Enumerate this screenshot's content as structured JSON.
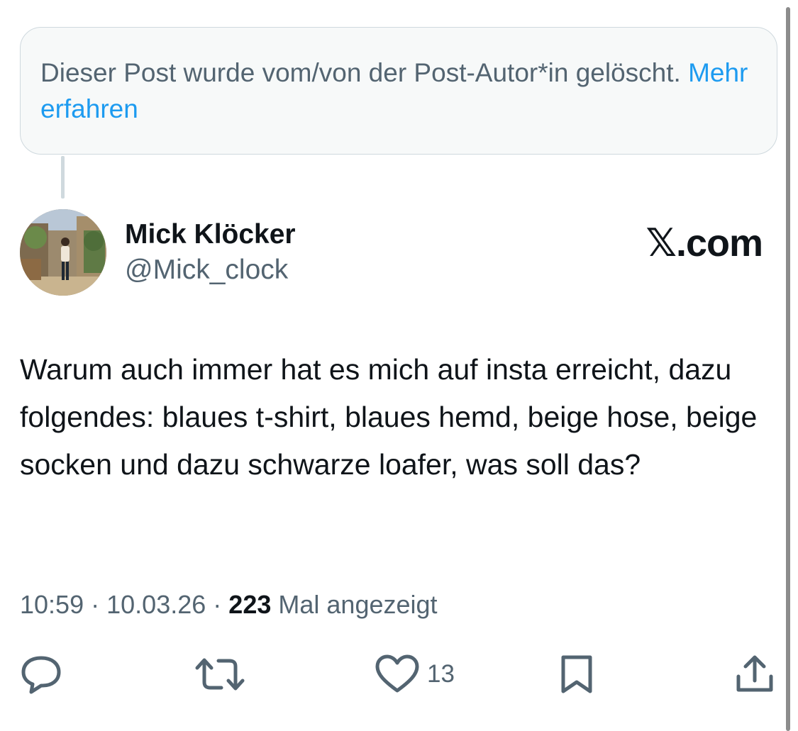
{
  "deleted_notice": {
    "text": "Dieser Post wurde vom/von der Post-Autor*in gelöscht.",
    "link": "Mehr erfahren"
  },
  "author": {
    "name": "Mick Klöcker",
    "handle": "@Mick_clock"
  },
  "brand": {
    "label": "𝕏.com"
  },
  "tweet": {
    "text": "Warum auch immer hat es mich auf insta erreicht, dazu folgendes: blaues t-shirt, blaues hemd, beige hose, beige socken und dazu schwarze loafer, was soll das?"
  },
  "meta": {
    "time": "10:59",
    "sep1": "·",
    "date": "10.03.26",
    "sep2": "·",
    "views_count": "223",
    "views_label": "Mal angezeigt"
  },
  "actions": {
    "reply_icon": "reply-icon",
    "retweet_icon": "retweet-icon",
    "like_icon": "heart-icon",
    "like_count": "13",
    "bookmark_icon": "bookmark-icon",
    "share_icon": "share-icon"
  },
  "colors": {
    "text_primary": "#0f1419",
    "text_secondary": "#536471",
    "link": "#1d9bf0",
    "border": "#cfd9de",
    "notice_bg": "#f7f9f9"
  }
}
